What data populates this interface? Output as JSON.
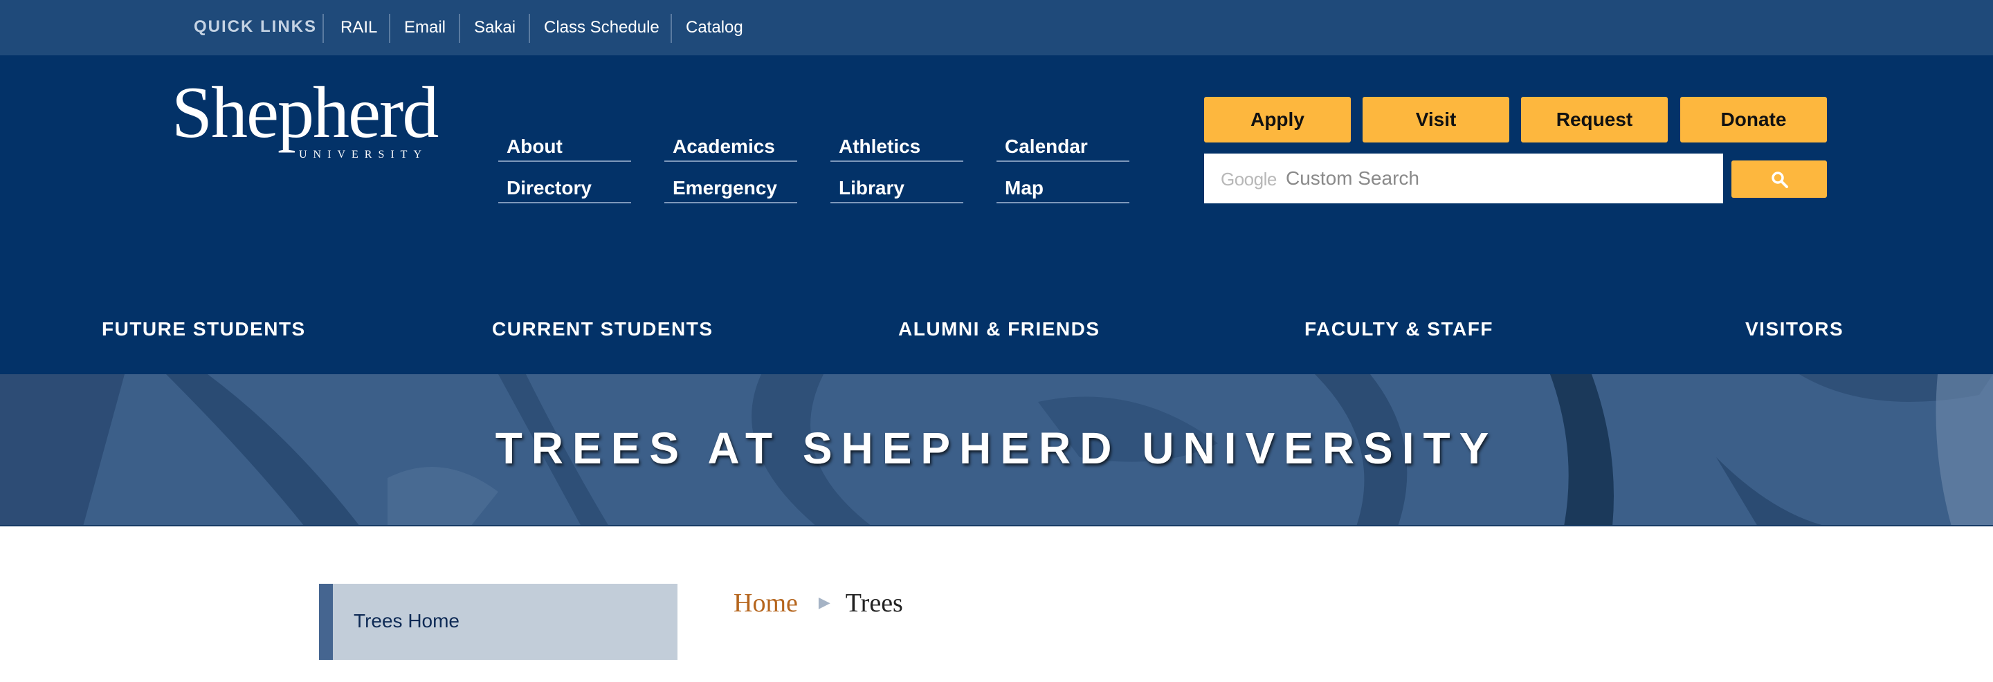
{
  "quick_links": {
    "title": "QUICK LINKS",
    "items": [
      "RAIL",
      "Email",
      "Sakai",
      "Class Schedule",
      "Catalog"
    ]
  },
  "logo": {
    "name": "Shepherd",
    "subtitle": "UNIVERSITY"
  },
  "utility_nav": {
    "items": [
      "About",
      "Academics",
      "Athletics",
      "Calendar",
      "Directory",
      "Emergency",
      "Library",
      "Map"
    ]
  },
  "cta_buttons": [
    "Apply",
    "Visit",
    "Request",
    "Donate"
  ],
  "search": {
    "brand": "Google",
    "placeholder": "Custom Search",
    "button_icon": "search-icon"
  },
  "audience_nav": [
    "FUTURE STUDENTS",
    "CURRENT STUDENTS",
    "ALUMNI & FRIENDS",
    "FACULTY & STAFF",
    "VISITORS"
  ],
  "banner": {
    "title": "TREES AT SHEPHERD UNIVERSITY"
  },
  "sidebar": {
    "items": [
      "Trees Home"
    ]
  },
  "breadcrumb": {
    "home": "Home",
    "separator_icon": "triangle-right-icon",
    "current": "Trees"
  },
  "colors": {
    "quickbar_bg": "#1f4a7a",
    "header_bg": "#033268",
    "accent_gold": "#fdb73e",
    "banner_bg": "#3c5f89",
    "link_orange": "#b5651d",
    "sidebar_bg": "#c2cdd9",
    "sidebar_accent": "#456590"
  }
}
